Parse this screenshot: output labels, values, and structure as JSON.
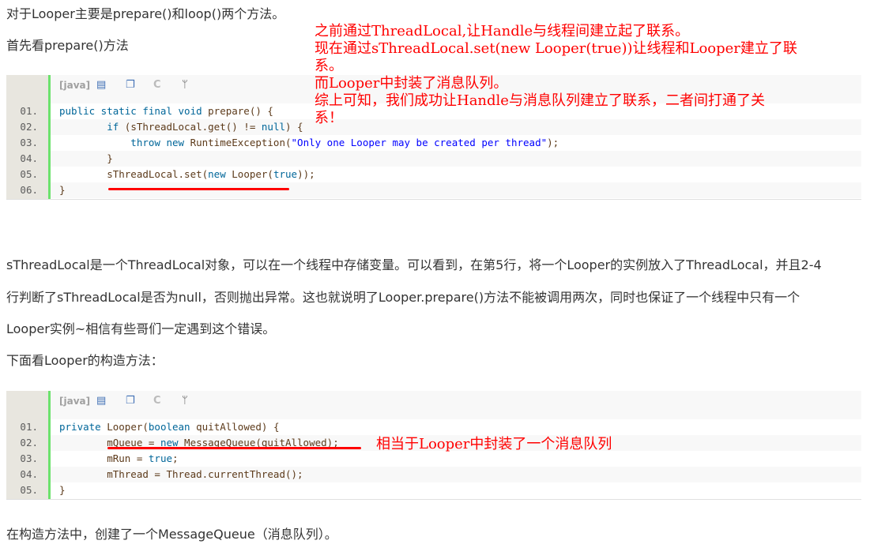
{
  "paragraphs": {
    "intro": "对于Looper主要是prepare()和loop()两个方法。",
    "first_look": "首先看prepare()方法",
    "explain_1": "sThreadLocal是一个ThreadLocal对象，可以在一个线程中存储变量。可以看到，在第5行，将一个Looper的实例放入了ThreadLocal，并且2-4",
    "explain_2": "行判断了sThreadLocal是否为null，否则抛出异常。这也就说明了Looper.prepare()方法不能被调用两次，同时也保证了一个线程中只有一个",
    "explain_3": "Looper实例~相信有些哥们一定遇到这个错误。",
    "constructor_intro": "下面看Looper的构造方法：",
    "conclusion": "在构造方法中，创建了一个MessageQueue（消息队列）。"
  },
  "toolbar": {
    "lang": "[java]",
    "icons": [
      "view-source-icon",
      "copy-icon",
      "print-icon",
      "fork-icon"
    ]
  },
  "code_blocks": [
    {
      "lines": [
        {
          "num": "01.",
          "tokens": [
            {
              "t": "public static final void ",
              "c": "kw"
            },
            {
              "t": "prepare() {",
              "c": ""
            }
          ]
        },
        {
          "num": "02.",
          "tokens": [
            {
              "t": "        if ",
              "c": "kw"
            },
            {
              "t": "(sThreadLocal.get() != ",
              "c": ""
            },
            {
              "t": "null",
              "c": "kw"
            },
            {
              "t": ") {",
              "c": ""
            }
          ]
        },
        {
          "num": "03.",
          "tokens": [
            {
              "t": "            throw new ",
              "c": "kw"
            },
            {
              "t": "RuntimeException(",
              "c": ""
            },
            {
              "t": "\"Only one Looper may be created per thread\"",
              "c": "str"
            },
            {
              "t": ");",
              "c": ""
            }
          ]
        },
        {
          "num": "04.",
          "tokens": [
            {
              "t": "        }",
              "c": ""
            }
          ]
        },
        {
          "num": "05.",
          "tokens": [
            {
              "t": "        sThreadLocal.set(",
              "c": ""
            },
            {
              "t": "new ",
              "c": "kw"
            },
            {
              "t": "Looper(",
              "c": ""
            },
            {
              "t": "true",
              "c": "kw"
            },
            {
              "t": "));",
              "c": ""
            }
          ]
        },
        {
          "num": "06.",
          "tokens": [
            {
              "t": "}",
              "c": ""
            }
          ]
        }
      ]
    },
    {
      "lines": [
        {
          "num": "01.",
          "tokens": [
            {
              "t": "private ",
              "c": "kw"
            },
            {
              "t": "Looper(",
              "c": ""
            },
            {
              "t": "boolean ",
              "c": "kw"
            },
            {
              "t": "quitAllowed) {",
              "c": ""
            }
          ]
        },
        {
          "num": "02.",
          "tokens": [
            {
              "t": "        mQueue = ",
              "c": ""
            },
            {
              "t": "new ",
              "c": "kw"
            },
            {
              "t": "MessageQueue(quitAllowed);",
              "c": ""
            }
          ]
        },
        {
          "num": "03.",
          "tokens": [
            {
              "t": "        mRun = ",
              "c": ""
            },
            {
              "t": "true",
              "c": "kw"
            },
            {
              "t": ";",
              "c": ""
            }
          ]
        },
        {
          "num": "04.",
          "tokens": [
            {
              "t": "        mThread = Thread.currentThread();",
              "c": ""
            }
          ]
        },
        {
          "num": "05.",
          "tokens": [
            {
              "t": "}",
              "c": ""
            }
          ]
        }
      ]
    }
  ],
  "annotations": {
    "top": [
      "之前通过ThreadLocal,让Handle与线程间建立起了联系。",
      "现在通过sThreadLocal.set(new Looper(true))让线程和Looper建立了联",
      "系。",
      "而Looper中封装了消息队列。",
      "综上可知，我们成功让Handle与消息队列建立了联系，二者间打通了关",
      "系！"
    ],
    "second": "相当于Looper中封装了一个消息队列",
    "color": "#ff0000"
  }
}
